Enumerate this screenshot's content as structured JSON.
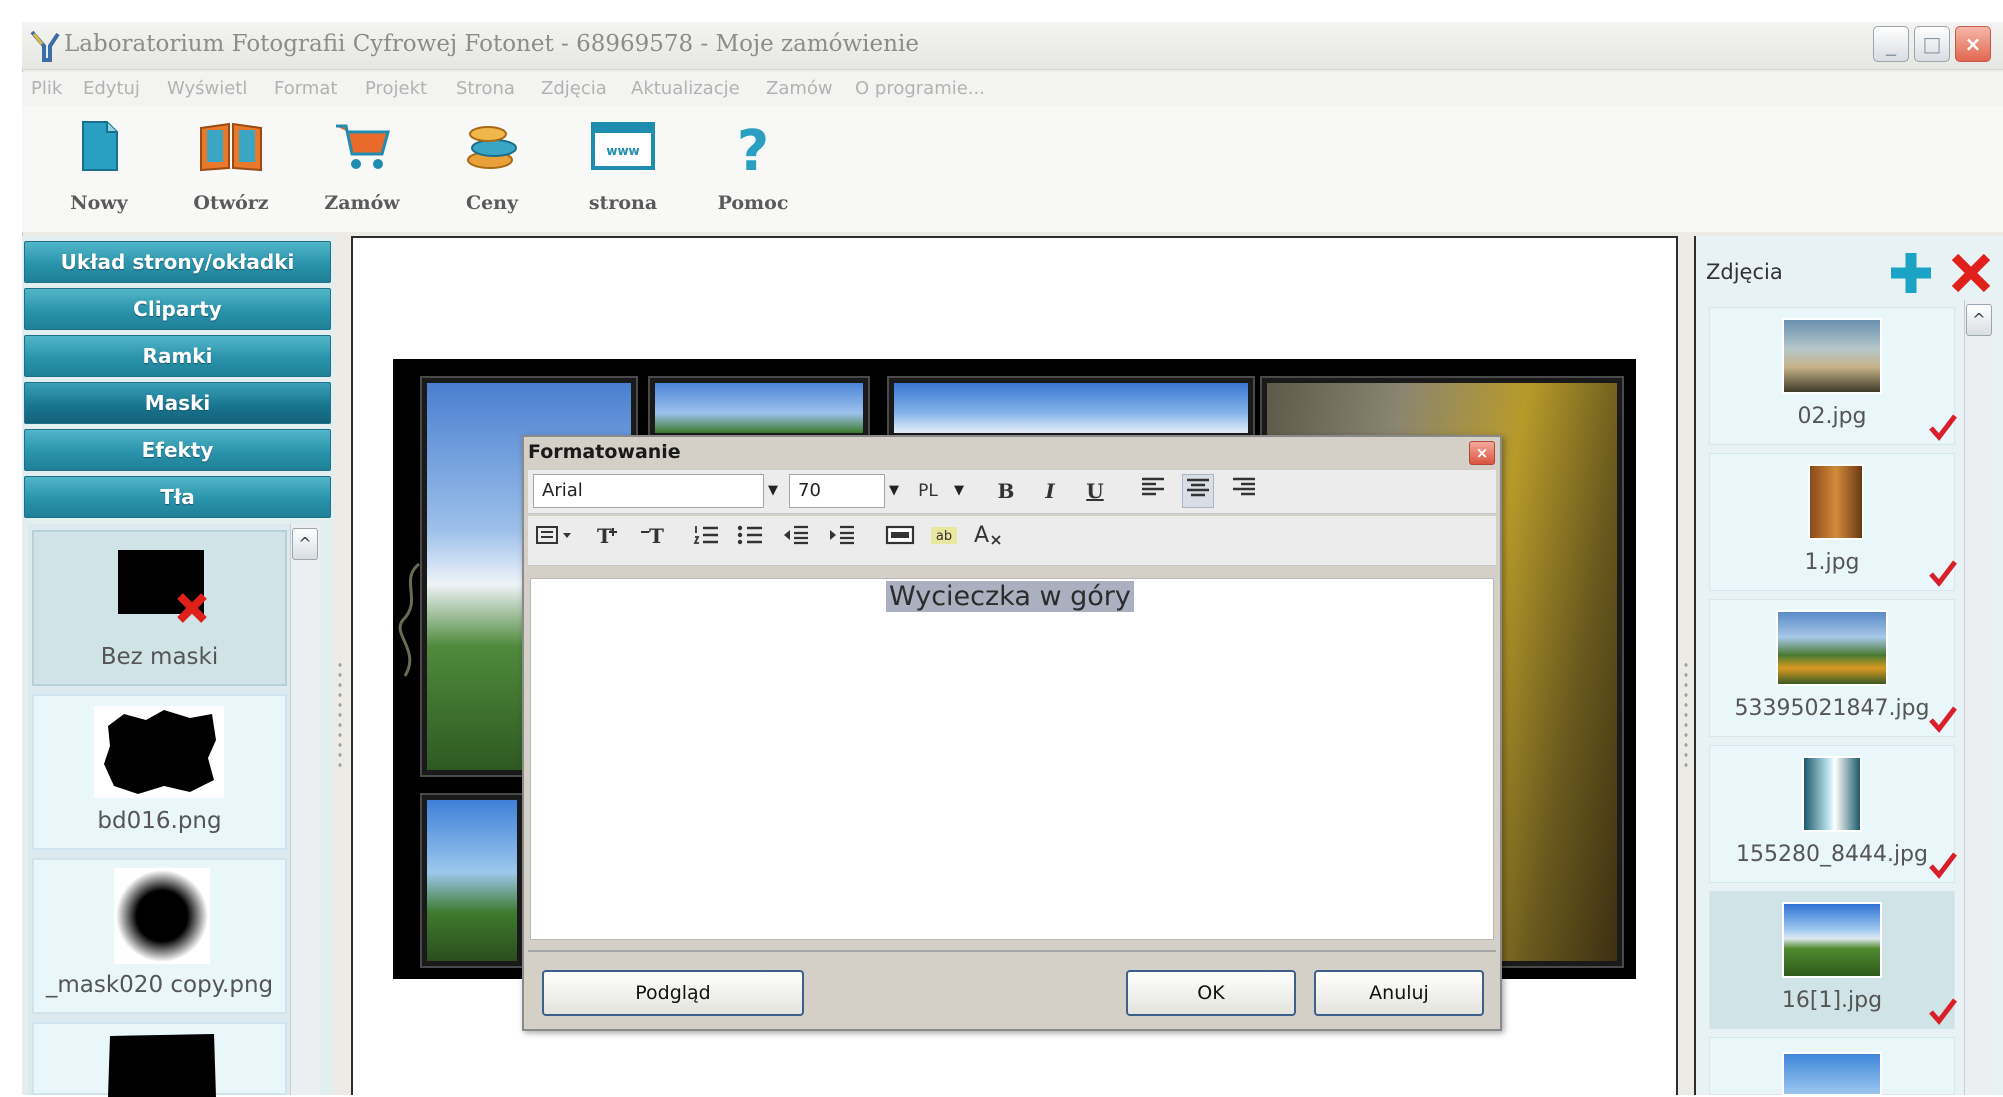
{
  "window": {
    "title": "Laboratorium Fotografii Cyfrowej Fotonet - 68969578 - Moje zamówienie",
    "controls": {
      "minimize": "_",
      "maximize": "□",
      "close": "×"
    }
  },
  "menu": [
    "Plik",
    "Edytuj",
    "Wyświetl",
    "Format",
    "Projekt",
    "Strona",
    "Zdjęcia",
    "Aktualizacje",
    "Zamów",
    "O programie..."
  ],
  "toolbar": [
    {
      "label": "Nowy",
      "icon": "new-document-icon"
    },
    {
      "label": "Otwórz",
      "icon": "open-book-icon"
    },
    {
      "label": "Zamów",
      "icon": "shopping-cart-icon"
    },
    {
      "label": "Ceny",
      "icon": "coins-icon"
    },
    {
      "label": "strona",
      "icon": "web-page-icon"
    },
    {
      "label": "Pomoc",
      "icon": "help-icon"
    }
  ],
  "left_panel": {
    "sections": [
      "Układ strony/okładki",
      "Cliparty",
      "Ramki",
      "Maski",
      "Efekty",
      "Tła"
    ],
    "active_section": "Maski",
    "masks": [
      {
        "label": "Bez maski"
      },
      {
        "label": "bd016.png"
      },
      {
        "label": "_mask020 copy.png"
      }
    ],
    "scroll_up": "^"
  },
  "dialog": {
    "title": "Formatowanie",
    "close": "×",
    "font": "Arial",
    "size": "70",
    "language": "PL",
    "format_buttons": {
      "bold": "B",
      "italic": "I",
      "underline": "U"
    },
    "text": "Wycieczka w góry",
    "buttons": {
      "preview": "Podgląd",
      "ok": "OK",
      "cancel": "Anuluj"
    }
  },
  "right_panel": {
    "title": "Zdjęcia",
    "photos": [
      {
        "name": "02.jpg"
      },
      {
        "name": "1.jpg"
      },
      {
        "name": "53395021847.jpg"
      },
      {
        "name": "155280_8444.jpg"
      },
      {
        "name": "16[1].jpg"
      }
    ]
  },
  "colors": {
    "accordion": "#2a93ab",
    "check_mark": "#d9202a",
    "add_icon": "#1aa3c4",
    "remove_icon": "#e0201a"
  }
}
